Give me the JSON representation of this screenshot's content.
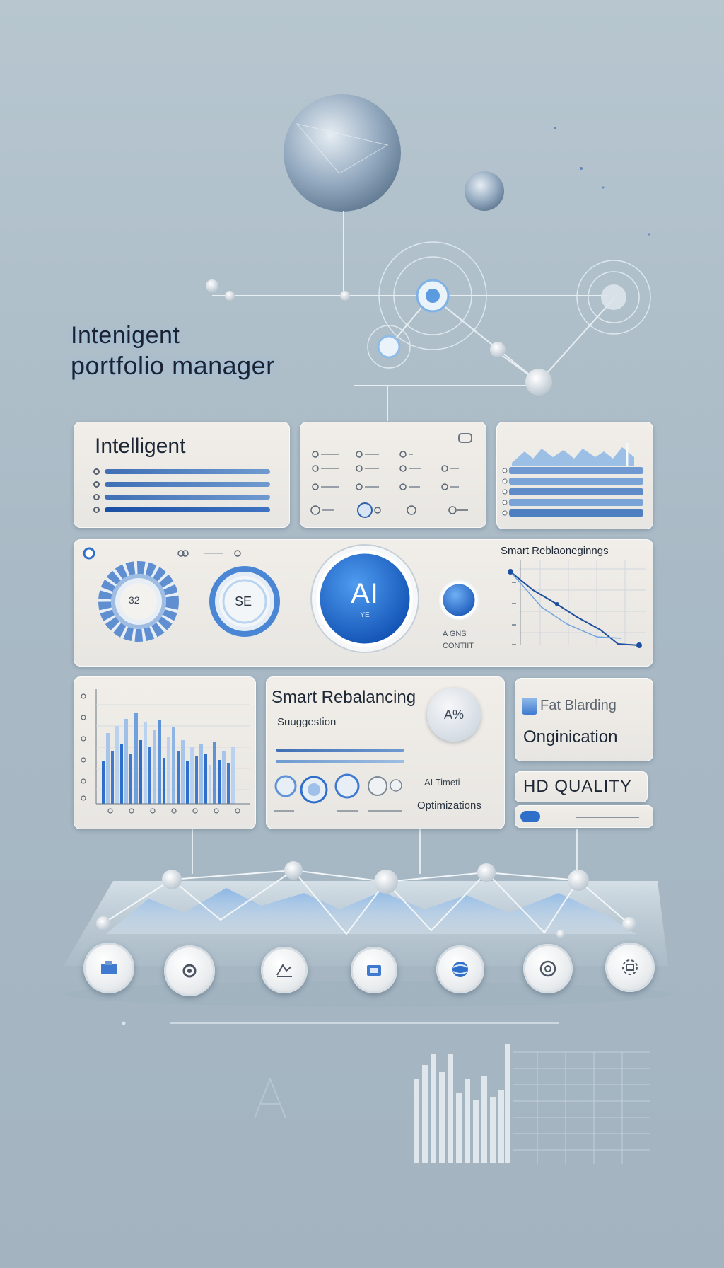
{
  "title": {
    "line1": "Intenigent",
    "line2": "portfolio manager"
  },
  "panel_intelligent": {
    "heading": "Intelligent"
  },
  "panel_ai": {
    "ai_label": "AI",
    "ai_sub": "YE",
    "left_gauge_value": "32",
    "mid_gauge_value": "SE",
    "top_label": "Smart Reblaoneginngs",
    "small_caption_1": "A GNS",
    "small_caption_2": "CONTIIT"
  },
  "panel_rebalancing": {
    "heading": "Smart Rebalancing",
    "subheading": "Suuggestion",
    "badge": "A%",
    "caption_1": "AI Timeti",
    "caption_2": "Optimizations"
  },
  "panel_right": {
    "heading_line1": "Fat Blarding",
    "heading_line2": "Onginication",
    "hd_label": "HD QUALITY"
  },
  "colors": {
    "accent": "#2f6fc9",
    "accent_dark": "#1b4fa3",
    "panel": "#eeece8",
    "background": "#aebdc8"
  },
  "icons": [
    "wallet-icon",
    "gear-icon",
    "chart-icon",
    "folder-icon",
    "globe-icon",
    "email-icon",
    "settings-icon"
  ]
}
